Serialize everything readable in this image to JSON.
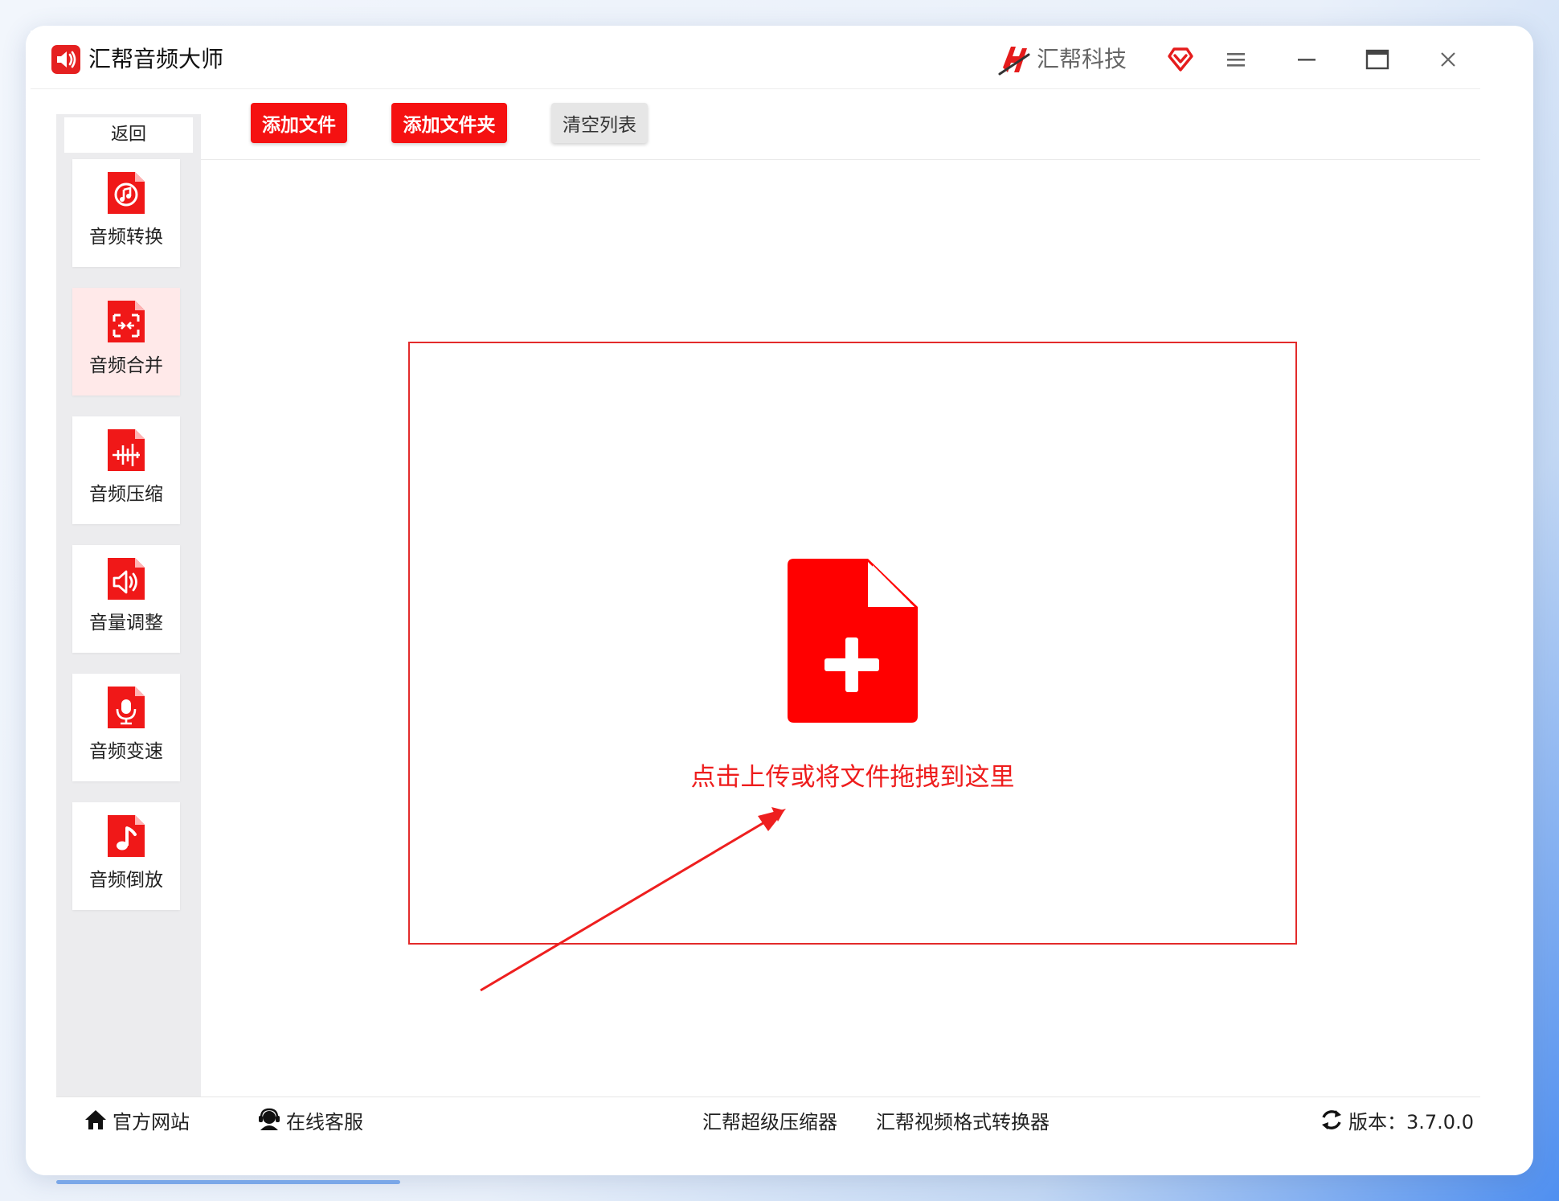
{
  "window": {
    "title": "汇帮音频大师",
    "brand_name": "汇帮科技"
  },
  "sidebar": {
    "back_label": "返回",
    "items": [
      {
        "label": "音频转换",
        "icon": "audio-convert-icon"
      },
      {
        "label": "音频合并",
        "icon": "audio-merge-icon",
        "active": true
      },
      {
        "label": "音频压缩",
        "icon": "audio-compress-icon"
      },
      {
        "label": "音量调整",
        "icon": "volume-adjust-icon"
      },
      {
        "label": "音频变速",
        "icon": "audio-speed-icon"
      },
      {
        "label": "音频倒放",
        "icon": "audio-reverse-icon"
      }
    ]
  },
  "toolbar": {
    "add_file_label": "添加文件",
    "add_folder_label": "添加文件夹",
    "clear_list_label": "清空列表"
  },
  "dropzone": {
    "text": "点击上传或将文件拖拽到这里",
    "icon": "file-add-icon"
  },
  "footer": {
    "website_label": "官方网站",
    "support_label": "在线客服",
    "compressor_link": "汇帮超级压缩器",
    "video_converter_link": "汇帮视频格式转换器",
    "version_label": "版本：3.7.0.0"
  },
  "colors": {
    "accent_red": "#f51111",
    "sidebar_bg": "#ececee",
    "active_item_bg": "#ffe9e9"
  }
}
